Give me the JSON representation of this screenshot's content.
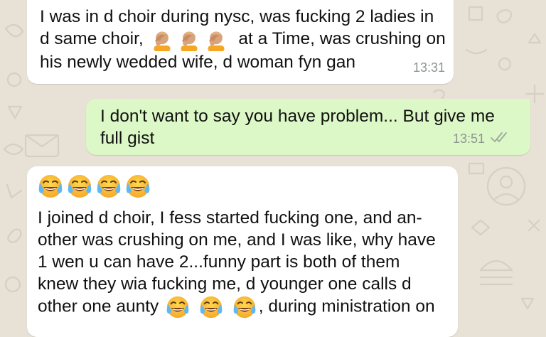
{
  "chat": {
    "messages": [
      {
        "direction": "incoming",
        "lines": [
          "I was in d choir during nysc, was fucking 2 ladies in",
          "d same choir,",
          "at a Time, was crushing on",
          "his newly wedded wife, d woman fyn gan"
        ],
        "inline_emoji": [
          "person-facepalming-emoji",
          "person-facepalming-emoji",
          "person-facepalming-emoji"
        ],
        "time": "13:31"
      },
      {
        "direction": "outgoing",
        "lines": [
          "I don't want to say you have problem... But give me",
          "full gist"
        ],
        "time": "13:51",
        "status_icon": "double-check-icon"
      },
      {
        "direction": "incoming",
        "leading_emoji": [
          "face-with-tears-of-joy-emoji",
          "face-with-tears-of-joy-emoji",
          "face-with-tears-of-joy-emoji",
          "face-with-tears-of-joy-emoji"
        ],
        "lines": [
          "I joined d choir, I fess started fucking one, and an-",
          "other was crushing on me, and I was like, why have",
          "1 wen u can have 2...funny part is both of them",
          "knew they wia fucking me, d younger one calls d",
          "other one aunty",
          ", during ministration on"
        ],
        "inline_emoji": [
          "face-with-tears-of-joy-emoji",
          "face-with-tears-of-joy-emoji",
          "face-with-tears-of-joy-emoji"
        ]
      }
    ]
  },
  "colors": {
    "wallpaper": "#e7e1d6",
    "incoming_bubble": "#ffffff",
    "outgoing_bubble": "#dcf8c6",
    "timestamp": "#8e9590"
  }
}
